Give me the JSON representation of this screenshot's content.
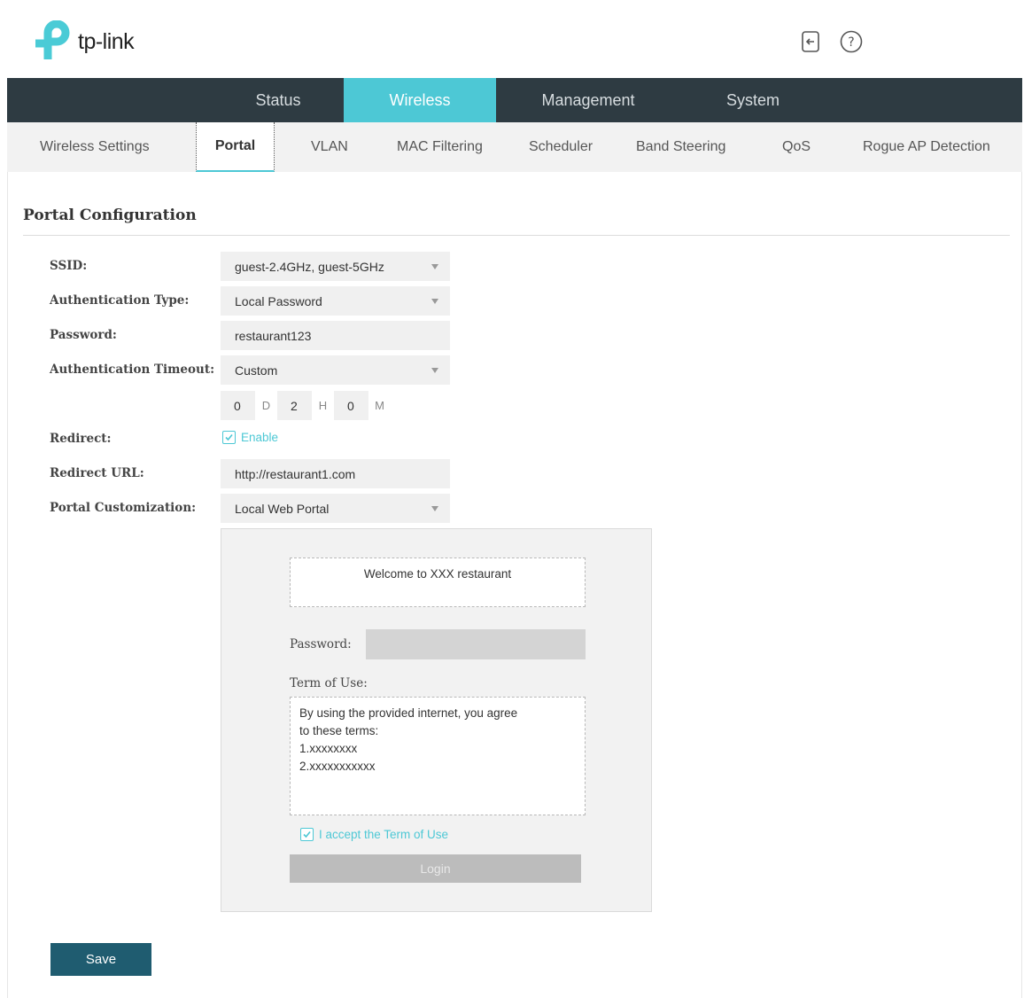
{
  "brand": {
    "logo_text": "tp-link",
    "accent": "#4dc8d5",
    "nav_bg": "#2e3b42",
    "save_bg": "#1f5c70"
  },
  "header": {
    "icons": [
      "logout-icon",
      "help-icon"
    ]
  },
  "nav": {
    "items": [
      {
        "label": "Status"
      },
      {
        "label": "Wireless",
        "active": true
      },
      {
        "label": "Management"
      },
      {
        "label": "System"
      }
    ]
  },
  "subnav": {
    "items": [
      {
        "label": "Wireless Settings"
      },
      {
        "label": "Portal",
        "active": true
      },
      {
        "label": "VLAN"
      },
      {
        "label": "MAC Filtering"
      },
      {
        "label": "Scheduler"
      },
      {
        "label": "Band Steering"
      },
      {
        "label": "QoS"
      },
      {
        "label": "Rogue AP Detection"
      }
    ]
  },
  "portal": {
    "title": "Portal Configuration",
    "ssid": {
      "label": "SSID:",
      "value": "guest-2.4GHz, guest-5GHz"
    },
    "auth_type": {
      "label": "Authentication Type:",
      "value": "Local Password"
    },
    "password": {
      "label": "Password:",
      "value": "restaurant123"
    },
    "auth_timeout": {
      "label": "Authentication Timeout:",
      "value": "Custom",
      "days": "0",
      "days_unit": "D",
      "hours": "2",
      "hours_unit": "H",
      "minutes": "0",
      "minutes_unit": "M"
    },
    "redirect": {
      "label": "Redirect:",
      "checkbox_label": "Enable",
      "checked": true
    },
    "redirect_url": {
      "label": "Redirect URL:",
      "value": "http://restaurant1.com"
    },
    "customization": {
      "label": "Portal Customization:",
      "value": "Local Web Portal"
    }
  },
  "preview": {
    "welcome": "Welcome to XXX restaurant",
    "password_label": "Password:",
    "terms_label": "Term of Use:",
    "terms_lines": [
      "By using the provided internet, you agree",
      "to these terms:",
      "1.xxxxxxxx",
      "2.xxxxxxxxxxx"
    ],
    "accept_label": "I accept the Term of Use",
    "accept_checked": true,
    "login_label": "Login"
  },
  "actions": {
    "save_label": "Save"
  }
}
